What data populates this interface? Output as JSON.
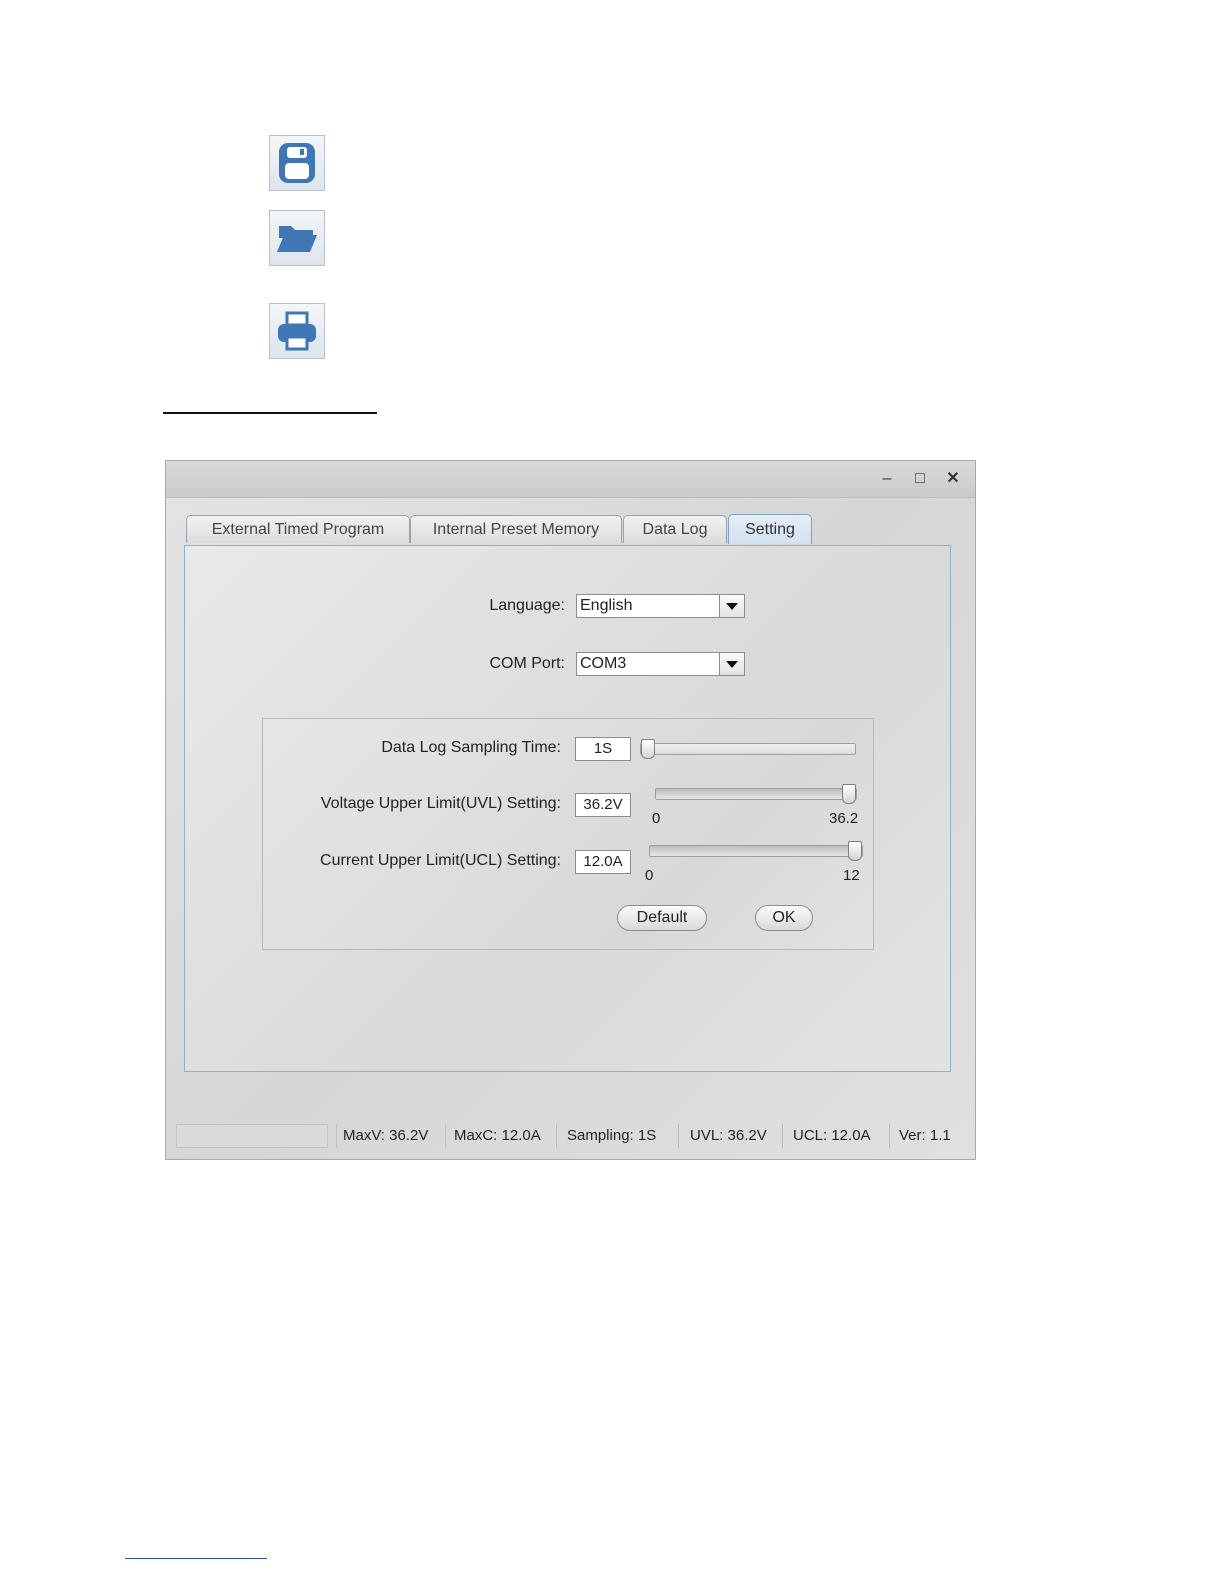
{
  "toolbar_icons": [
    {
      "name": "save-icon"
    },
    {
      "name": "open-folder-icon"
    },
    {
      "name": "print-icon"
    }
  ],
  "window": {
    "controls": {
      "minimize": "–",
      "maximize": "□",
      "close": "✕"
    },
    "tabs": [
      {
        "label": "External Timed Program",
        "active": false
      },
      {
        "label": "Internal Preset Memory",
        "active": false
      },
      {
        "label": "Data Log",
        "active": false
      },
      {
        "label": "Setting",
        "active": true
      }
    ],
    "settings": {
      "language_label": "Language:",
      "language_value": "English",
      "com_port_label": "COM Port:",
      "com_port_value": "COM3",
      "sampling_label": "Data Log Sampling Time:",
      "sampling_value": "1S",
      "sampling_level": 0.0,
      "uvl_label": "Voltage Upper Limit(UVL) Setting:",
      "uvl_value": "36.2V",
      "uvl_min": "0",
      "uvl_max": "36.2",
      "uvl_level": 1.0,
      "ucl_label": "Current Upper Limit(UCL) Setting:",
      "ucl_value": "12.0A",
      "ucl_min": "0",
      "ucl_max": "12",
      "ucl_level": 1.0,
      "default_button": "Default",
      "ok_button": "OK"
    },
    "status": {
      "maxv": "MaxV: 36.2V",
      "maxc": "MaxC: 12.0A",
      "sampling": "Sampling: 1S",
      "uvl": "UVL: 36.2V",
      "ucl": "UCL: 12.0A",
      "ver": "Ver: 1.1"
    }
  }
}
